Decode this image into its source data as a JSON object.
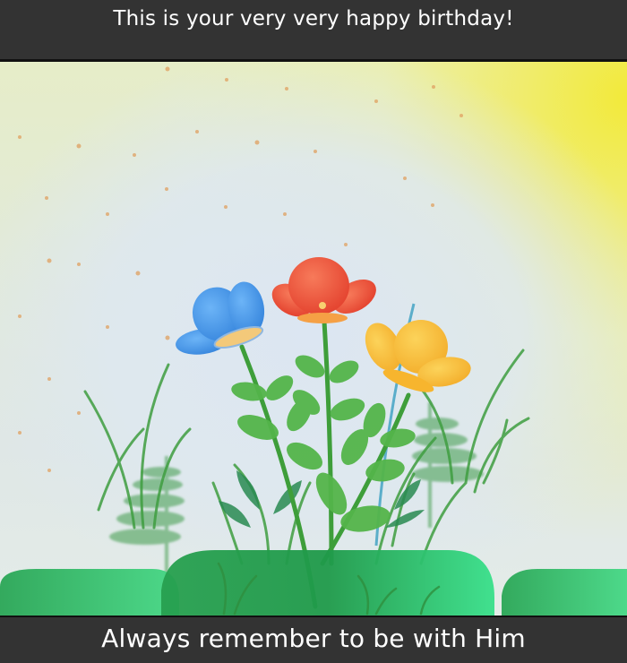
{
  "header": {
    "title": "This is your very very happy birthday!"
  },
  "footer": {
    "subtitle": "Always remember to be with Him"
  },
  "scene": {
    "flowers": [
      {
        "name": "blue-flower",
        "color": "#3f8fe6"
      },
      {
        "name": "red-flower",
        "color": "#ee4b33"
      },
      {
        "name": "yellow-flower",
        "color": "#f6b82e"
      }
    ],
    "colors": {
      "leaf": "#4fb34f",
      "stem": "#3e9e3a",
      "ground": "#2fb866",
      "sun": "#f2ea3a"
    }
  }
}
